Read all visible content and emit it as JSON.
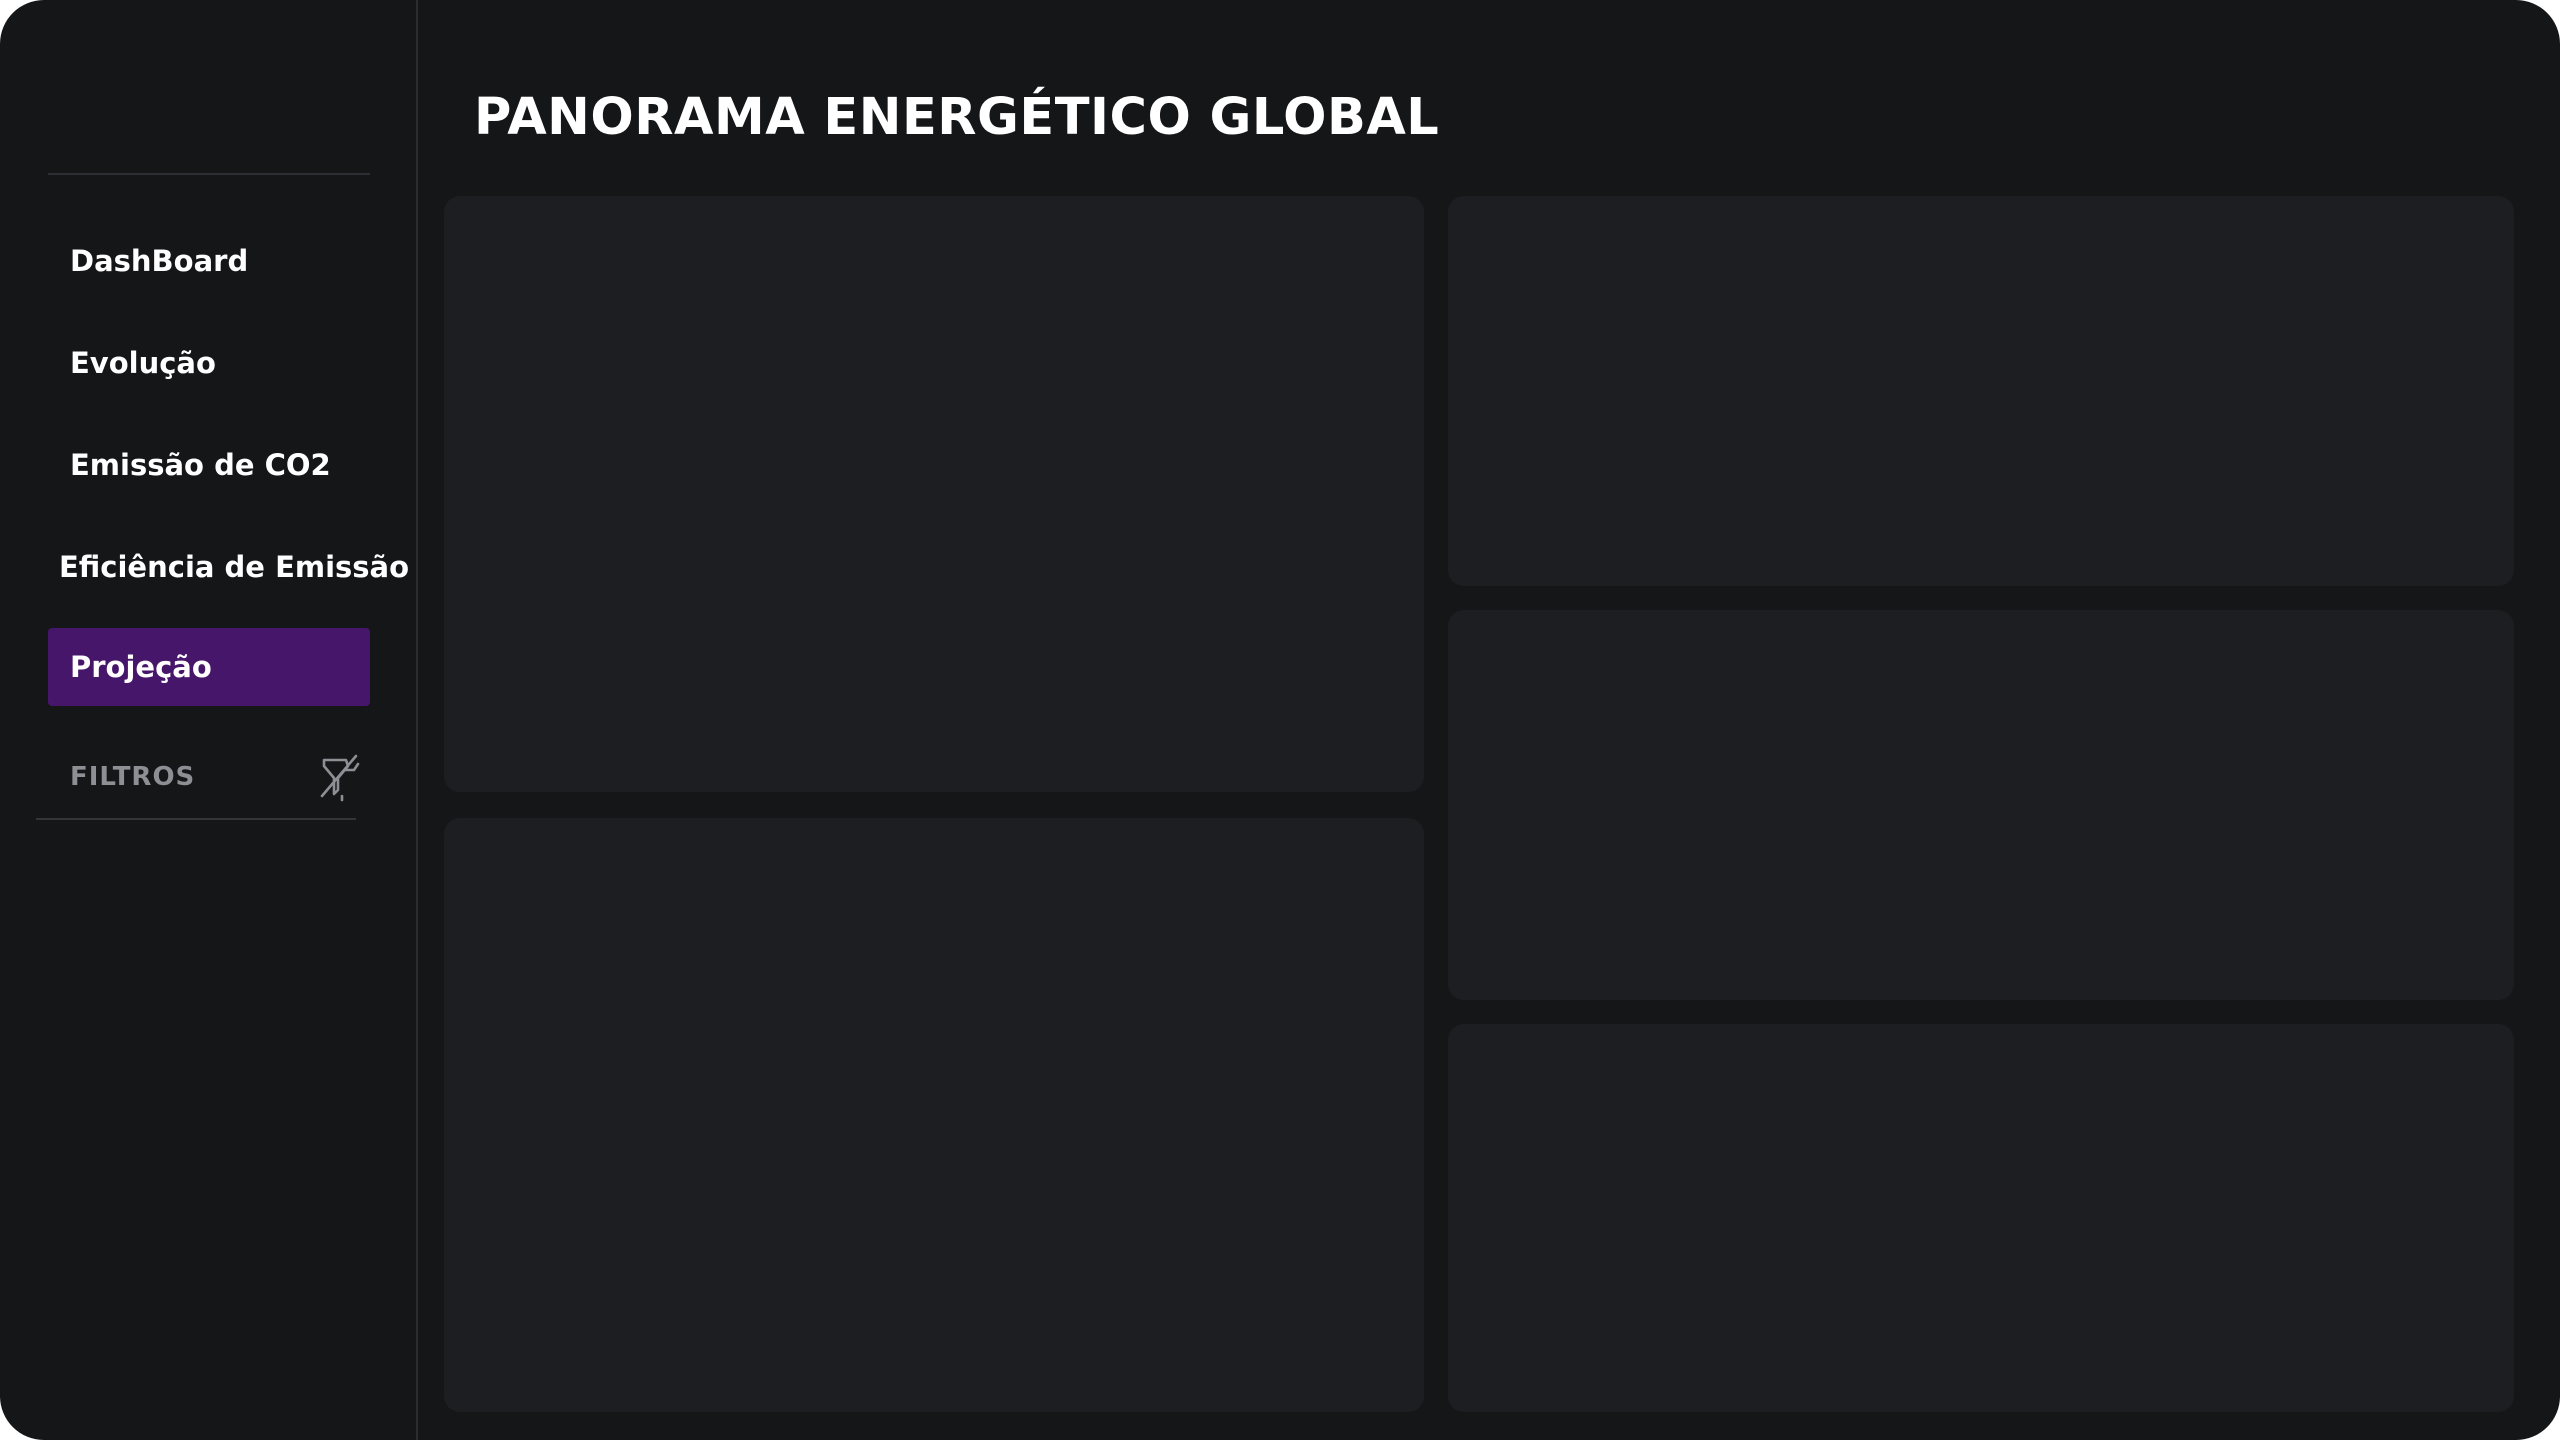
{
  "header": {
    "title": "PANORAMA ENERGÉTICO GLOBAL"
  },
  "sidebar": {
    "items": [
      {
        "label": "DashBoard",
        "active": false
      },
      {
        "label": "Evolução",
        "active": false
      },
      {
        "label": "Emissão de CO2",
        "active": false
      },
      {
        "label": "Eficiência de Emissão",
        "active": false
      },
      {
        "label": "Projeção",
        "active": true
      }
    ],
    "filters": {
      "label": "FILTROS",
      "icon": "filter-off-icon"
    }
  },
  "colors": {
    "app_background": "#151618",
    "card_background": "#1c1e22",
    "active_item": "#46166a",
    "text_primary": "#ffffff",
    "text_muted": "#8d8f94"
  }
}
